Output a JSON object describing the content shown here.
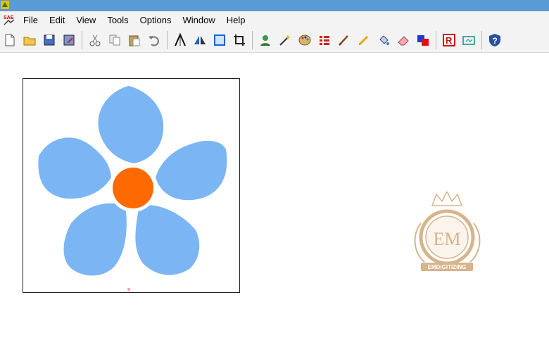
{
  "window": {
    "app_icon": "sae-app-icon"
  },
  "menu": {
    "app_icon_label": "SAE",
    "items": [
      "File",
      "Edit",
      "View",
      "Tools",
      "Options",
      "Window",
      "Help"
    ]
  },
  "toolbar": {
    "icons": [
      "new-file-icon",
      "open-folder-icon",
      "save-icon",
      "save-as-icon",
      "cut-icon",
      "copy-icon",
      "paste-icon",
      "undo-icon",
      "stitch-icon",
      "mirror-icon",
      "select-frame-icon",
      "crop-icon",
      "user-icon",
      "magic-wand-icon",
      "palette-icon",
      "stitch-list-icon",
      "brush-icon",
      "pencil-icon",
      "fill-icon",
      "eraser-icon",
      "color-swap-icon",
      "r-icon",
      "convert-icon",
      "help-icon"
    ]
  },
  "design": {
    "petal_color": "#7bb5f4",
    "center_color": "#ff6a00"
  },
  "watermark": {
    "initials": "EM",
    "text": "EMDIGITIZING",
    "color": "#d6b48c"
  }
}
